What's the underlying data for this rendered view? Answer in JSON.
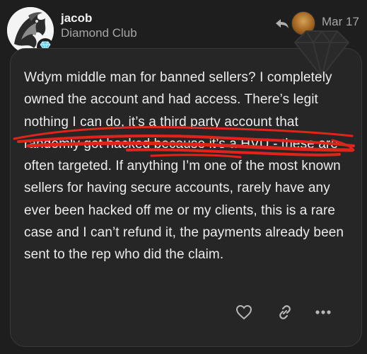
{
  "post": {
    "author": "jacob",
    "user_title": "Diamond Club",
    "date": "Mar 17",
    "body": "Wdym middle man for banned sellers? I completely owned the account and had access. There’s legit nothing I can do, it’s a third party account that randomly got hacked because it’s a HVU - these are often targeted. If anything I’m one of the most known sellers for having secure accounts, rarely have any ever been hacked off me or my clients, this is a rare case and I can’t refund it, the payments already been sent to the rep who did the claim."
  },
  "icons": {
    "reply": "reply-arrow-icon",
    "like": "heart-icon",
    "link": "link-icon",
    "more": "more-dots-icon",
    "badge": "diamond-badge-icon"
  },
  "colors": {
    "background": "#1e1e1e",
    "card": "#262626",
    "text": "#ececec",
    "muted": "#a6a6a6",
    "scribble": "#e0241b",
    "badge": "#5fd0f0"
  }
}
